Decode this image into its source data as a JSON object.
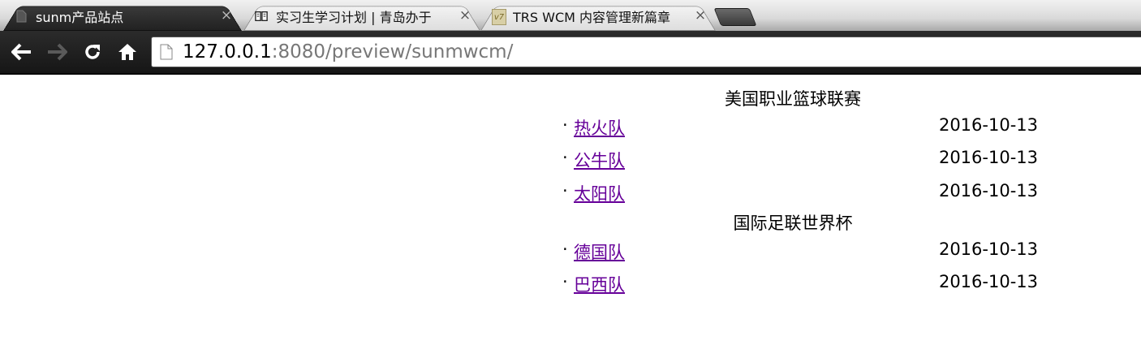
{
  "browser": {
    "tabs": [
      {
        "title": "sunm产品站点",
        "close": "×",
        "favicon": "page-icon",
        "active": true
      },
      {
        "title": "实习生学习计划 | 青岛办于",
        "close": "×",
        "favicon": "book-icon",
        "active": false
      },
      {
        "title": "TRS WCM 内容管理新篇章",
        "close": "×",
        "favicon": "v7",
        "active": false
      }
    ],
    "nav": {
      "back": "back-arrow-icon",
      "forward": "forward-arrow-icon",
      "reload": "reload-icon",
      "home": "home-icon"
    },
    "address": {
      "host": "127.0.0.1",
      "rest": ":8080/preview/sunmwcm/"
    }
  },
  "page": {
    "sections": [
      {
        "title": "美国职业篮球联赛",
        "items": [
          {
            "bullet": "·",
            "name": "热火队",
            "date": "2016-10-13"
          },
          {
            "bullet": "·",
            "name": "公牛队",
            "date": "2016-10-13"
          },
          {
            "bullet": "·",
            "name": "太阳队",
            "date": "2016-10-13"
          }
        ]
      },
      {
        "title": "国际足联世界杯",
        "items": [
          {
            "bullet": "·",
            "name": "德国队",
            "date": "2016-10-13"
          },
          {
            "bullet": "·",
            "name": "巴西队",
            "date": "2016-10-13"
          }
        ]
      }
    ]
  },
  "colors": {
    "link_visited": "#660099",
    "toolbar_bg": "#1f1f1f",
    "url_host": "#000000",
    "url_rest": "#777777"
  }
}
